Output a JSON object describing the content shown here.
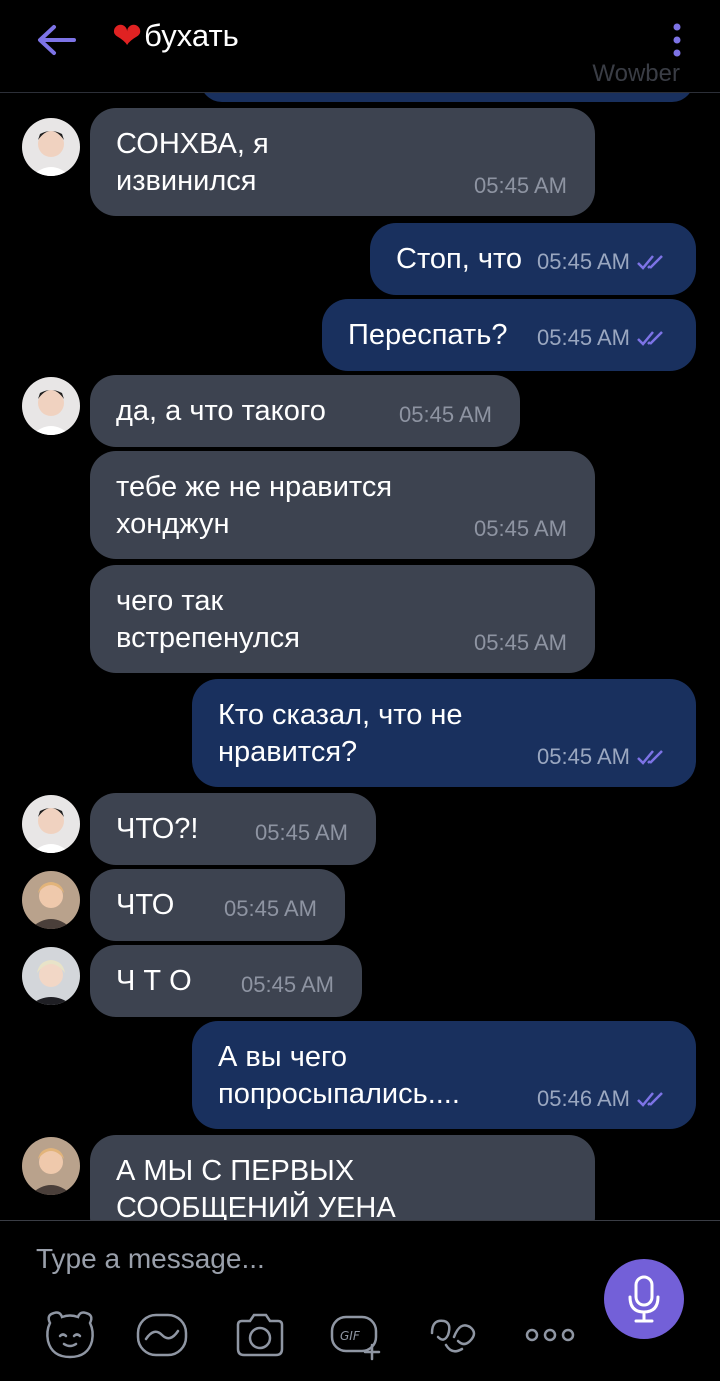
{
  "header": {
    "title": "бухать",
    "watermark": "Wowber"
  },
  "messages": [
    {
      "side": "in",
      "avatar": "avatar-a",
      "text": "СОНХВА, я\nизвинился",
      "time": "05:45 AM"
    },
    {
      "side": "out",
      "text": "Стоп, что",
      "time": "05:45 AM"
    },
    {
      "side": "out",
      "text": "Переспать?",
      "time": "05:45 AM"
    },
    {
      "side": "in",
      "avatar": "avatar-a",
      "text": "да, а что такого",
      "time": "05:45 AM"
    },
    {
      "side": "in",
      "text": "тебе же не нравится\nхонджун",
      "time": "05:45 AM"
    },
    {
      "side": "in",
      "text": "чего так\nвстрепенулся",
      "time": "05:45 AM"
    },
    {
      "side": "out",
      "text": "Кто сказал, что не\nнравится?",
      "time": "05:45 AM"
    },
    {
      "side": "in",
      "avatar": "avatar-a",
      "text": "ЧТО?!",
      "time": "05:45 AM"
    },
    {
      "side": "in",
      "avatar": "avatar-b",
      "text": "ЧТО",
      "time": "05:45 AM"
    },
    {
      "side": "in",
      "avatar": "avatar-c",
      "text": "Ч Т О",
      "time": "05:45 AM"
    },
    {
      "side": "out",
      "text": "А вы чего\nпопросыпались....",
      "time": "05:46 AM"
    },
    {
      "side": "in",
      "avatar": "avatar-b",
      "text": "А МЫ С ПЕРВЫХ\nСООБЩЕНИЙ УЕНА",
      "time": ""
    }
  ],
  "composer": {
    "placeholder": "Type a message...",
    "tools": [
      "sticker-icon",
      "doodle-icon",
      "camera-icon",
      "gif-icon",
      "emoticon-icon",
      "more-icon"
    ]
  },
  "colors": {
    "background": "#000000",
    "incoming": "#3d4350",
    "outgoing": "#19305e",
    "accent": "#7360d8",
    "heart": "#e02222"
  }
}
